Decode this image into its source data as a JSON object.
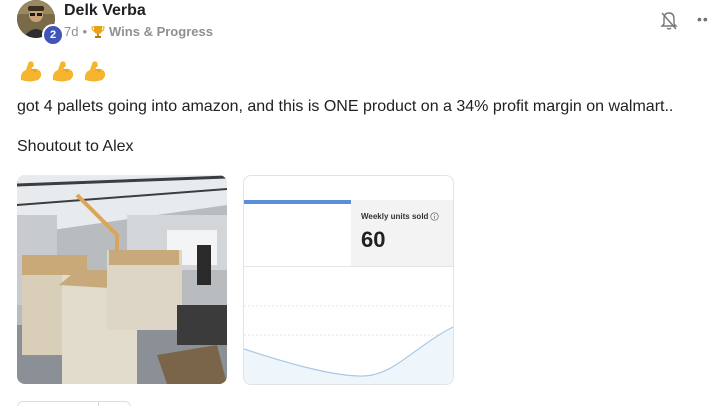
{
  "author": {
    "name": "Delk Verba",
    "level": "2",
    "avatar_icon": "person-avatar"
  },
  "meta": {
    "time": "7d",
    "separator": "•",
    "category_icon": "trophy-icon",
    "category": "Wins & Progress"
  },
  "actions": {
    "bell_icon": "bell-icon",
    "more_icon": "more-icon",
    "more_glyph": "••"
  },
  "post": {
    "emoji_count": 3,
    "emoji": "flexed-biceps",
    "body": "got 4 pallets going into amazon, and this is ONE product on a 34% profit margin on walmart..",
    "shoutout": "Shoutout to Alex"
  },
  "attachments": {
    "photo_subject": "warehouse-pallets",
    "stat_card": {
      "label": "Weekly units sold",
      "value": "60",
      "accent_color": "#5b8fd6",
      "line_color": "#a8c8e4",
      "fill_color": "#eef5fb"
    }
  }
}
